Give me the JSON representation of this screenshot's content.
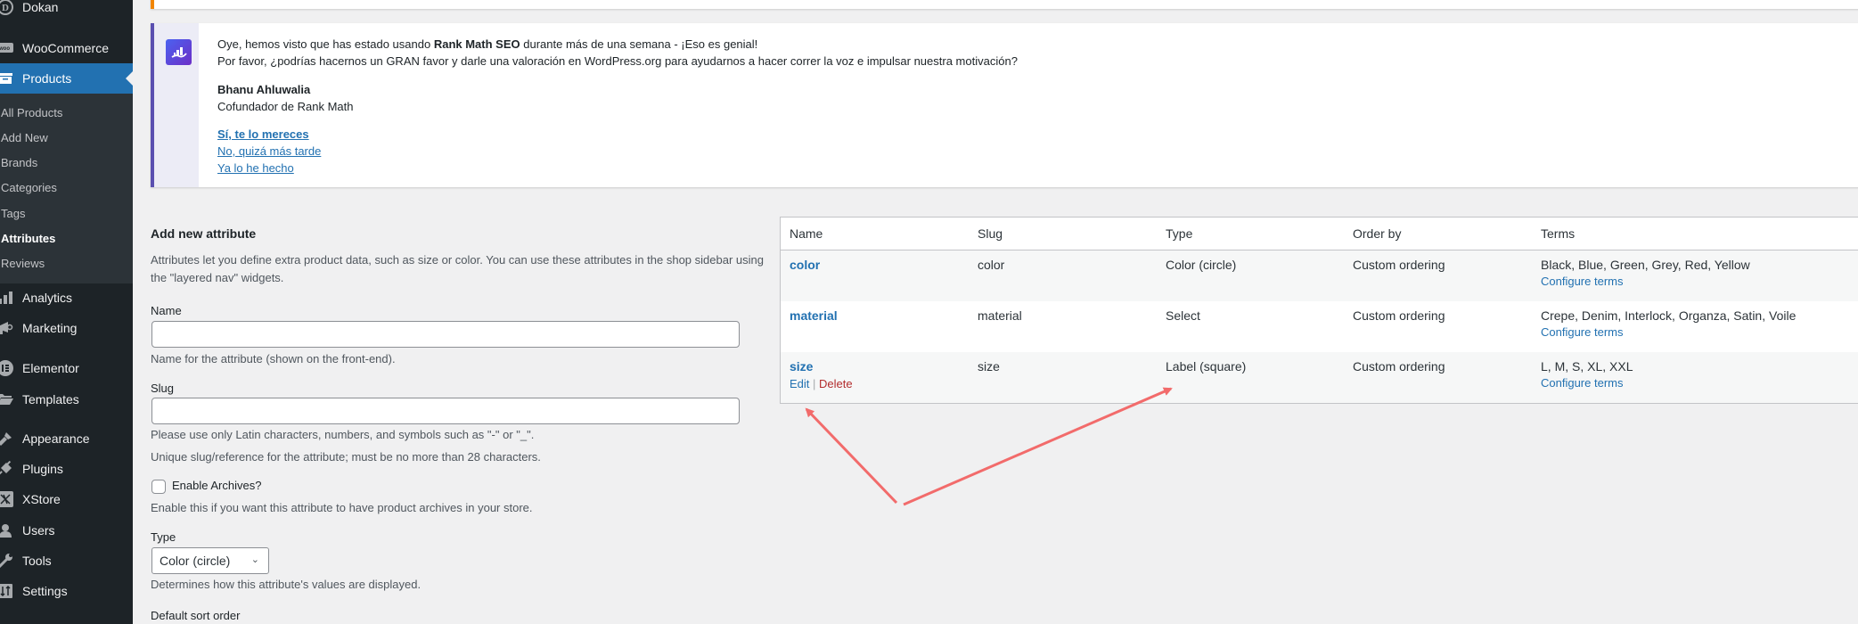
{
  "sidebar": {
    "items": [
      {
        "label": "Dokan",
        "icon": "dokan-icon"
      },
      {
        "label": "WooCommerce",
        "icon": "woocommerce-icon"
      },
      {
        "label": "Products",
        "icon": "products-icon",
        "active": true
      },
      {
        "label": "Analytics",
        "icon": "analytics-icon"
      },
      {
        "label": "Marketing",
        "icon": "megaphone-icon"
      },
      {
        "label": "Elementor",
        "icon": "elementor-icon"
      },
      {
        "label": "Templates",
        "icon": "folder-icon"
      },
      {
        "label": "Appearance",
        "icon": "paintbrush-icon"
      },
      {
        "label": "Plugins",
        "icon": "plug-icon"
      },
      {
        "label": "XStore",
        "icon": "xstore-icon"
      },
      {
        "label": "Users",
        "icon": "user-icon"
      },
      {
        "label": "Tools",
        "icon": "wrench-icon"
      },
      {
        "label": "Settings",
        "icon": "settings-icon"
      }
    ],
    "submenu": [
      {
        "label": "All Products"
      },
      {
        "label": "Add New"
      },
      {
        "label": "Brands"
      },
      {
        "label": "Categories"
      },
      {
        "label": "Tags"
      },
      {
        "label": "Attributes",
        "current": true
      },
      {
        "label": "Reviews"
      }
    ]
  },
  "notice": {
    "line1_pre": "Oye, hemos visto que has estado usando ",
    "line1_bold": "Rank Math SEO",
    "line1_post": " durante más de una semana - ¡Eso es genial!",
    "line2": "Por favor, ¿podrías hacernos un GRAN favor y darle una valoración en WordPress.org para ayudarnos a hacer correr la voz e impulsar nuestra motivación?",
    "author": "Bhanu Ahluwalia",
    "author_role": "Cofundador de Rank Math",
    "links": [
      "Sí, te lo mereces",
      "No, quizá más tarde",
      "Ya lo he hecho"
    ]
  },
  "form": {
    "title": "Add new attribute",
    "intro": "Attributes let you define extra product data, such as size or color. You can use these attributes in the shop sidebar using the \"layered nav\" widgets.",
    "name_label": "Name",
    "name_value": "",
    "name_help": "Name for the attribute (shown on the front-end).",
    "slug_label": "Slug",
    "slug_value": "",
    "slug_help1": "Please use only Latin characters, numbers, and symbols such as \"-\" or \"_\".",
    "slug_help2": "Unique slug/reference for the attribute; must be no more than 28 characters.",
    "archives_label": "Enable Archives?",
    "archives_checked": false,
    "archives_help": "Enable this if you want this attribute to have product archives in your store.",
    "type_label": "Type",
    "type_value": "Color (circle)",
    "type_help": "Determines how this attribute's values are displayed.",
    "sort_label": "Default sort order"
  },
  "table": {
    "headers": [
      "Name",
      "Slug",
      "Type",
      "Order by",
      "Terms"
    ],
    "rows": [
      {
        "name": "color",
        "slug": "color",
        "type": "Color (circle)",
        "order_by": "Custom ordering",
        "terms": "Black, Blue, Green, Grey, Red, Yellow",
        "configure": "Configure terms"
      },
      {
        "name": "material",
        "slug": "material",
        "type": "Select",
        "order_by": "Custom ordering",
        "terms": "Crepe, Denim, Interlock, Organza, Satin, Voile",
        "configure": "Configure terms"
      },
      {
        "name": "size",
        "slug": "size",
        "type": "Label (square)",
        "order_by": "Custom ordering",
        "terms": "L, M, S, XL, XXL",
        "configure": "Configure terms",
        "actions": {
          "edit": "Edit",
          "sep": "|",
          "delete": "Delete"
        }
      }
    ]
  },
  "annotation": {
    "color": "#f26b6b"
  }
}
